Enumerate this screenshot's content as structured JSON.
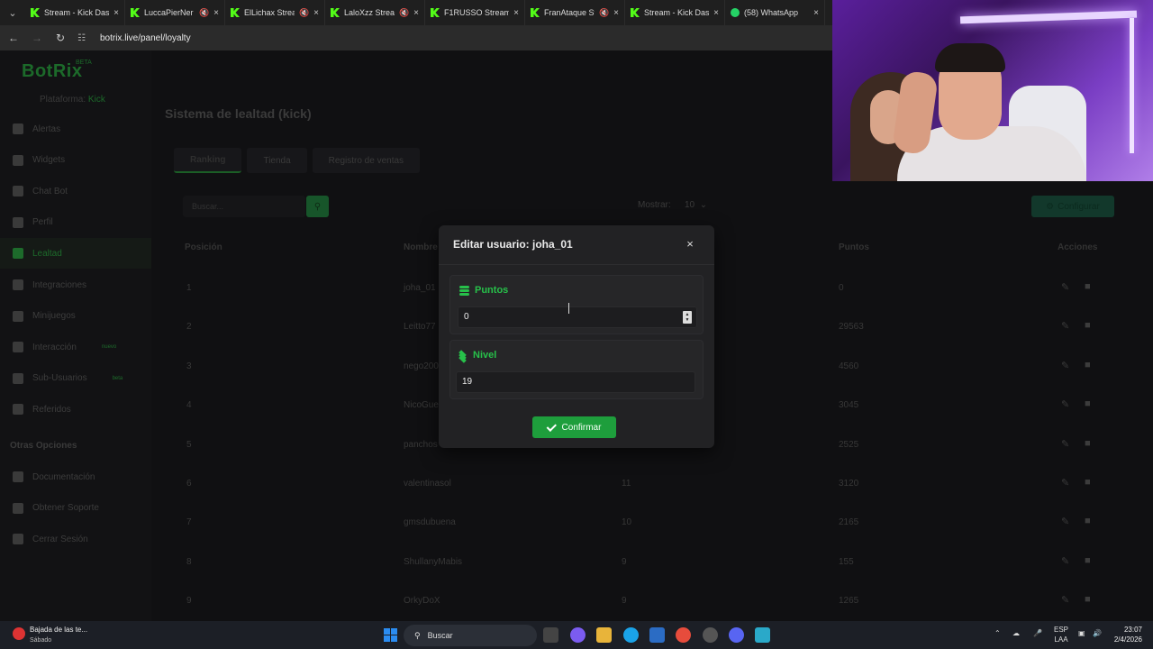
{
  "browser": {
    "tabs": [
      {
        "label": "Stream - Kick Das",
        "icon": "kick-icon",
        "muted": false
      },
      {
        "label": "LuccaPierNer",
        "icon": "kick-icon",
        "muted": true
      },
      {
        "label": "ElLichax Stream",
        "icon": "kick-icon",
        "muted": true
      },
      {
        "label": "LaloXzz Stream",
        "icon": "kick-icon",
        "muted": true
      },
      {
        "label": "F1RUSSO Stream",
        "icon": "kick-icon",
        "muted": false
      },
      {
        "label": "FranAtaque St",
        "icon": "kick-icon",
        "muted": true
      },
      {
        "label": "Stream - Kick Das",
        "icon": "kick-icon",
        "muted": false
      },
      {
        "label": "(58) WhatsApp",
        "icon": "whatsapp-icon",
        "muted": false
      }
    ],
    "url": "botrix.live/panel/loyalty"
  },
  "sidebar": {
    "logo": "BotRix",
    "beta": "BETA",
    "platform_label": "Plataforma:",
    "platform_value": "Kick",
    "items": [
      {
        "label": "Alertas"
      },
      {
        "label": "Widgets"
      },
      {
        "label": "Chat Bot"
      },
      {
        "label": "Perfil"
      },
      {
        "label": "Lealtad"
      },
      {
        "label": "Integraciones"
      },
      {
        "label": "Minijuegos"
      },
      {
        "label": "Interacción",
        "badge": "nuevo"
      },
      {
        "label": "Sub-Usuarios",
        "badge": "beta"
      },
      {
        "label": "Referidos"
      }
    ],
    "section": "Otras Opciones",
    "other_items": [
      {
        "label": "Documentación"
      },
      {
        "label": "Obtener Soporte"
      },
      {
        "label": "Cerrar Sesión"
      }
    ]
  },
  "main": {
    "title": "Sistema de lealtad (kick)",
    "tabs": [
      "Ranking",
      "Tienda",
      "Registro de ventas"
    ],
    "search_placeholder": "Buscar...",
    "show_label": "Mostrar:",
    "show_value": "10",
    "config_label": "Configurar",
    "columns": [
      "Posición",
      "Nombre",
      "Puntos",
      "Acciones"
    ],
    "rows": [
      {
        "pos": "1",
        "name": "joha_01",
        "level": "",
        "points": "0"
      },
      {
        "pos": "2",
        "name": "Leitto77",
        "level": "",
        "points": "29563"
      },
      {
        "pos": "3",
        "name": "nego200",
        "level": "",
        "points": "4560"
      },
      {
        "pos": "4",
        "name": "NicoGue",
        "level": "",
        "points": "3045"
      },
      {
        "pos": "5",
        "name": "panchos",
        "level": "",
        "points": "2525"
      },
      {
        "pos": "6",
        "name": "valentinasol",
        "level": "11",
        "points": "3120"
      },
      {
        "pos": "7",
        "name": "gmsdubuena",
        "level": "10",
        "points": "2165"
      },
      {
        "pos": "8",
        "name": "ShullanyMabis",
        "level": "9",
        "points": "155"
      },
      {
        "pos": "9",
        "name": "OrkyDoX",
        "level": "9",
        "points": "1265"
      }
    ]
  },
  "modal": {
    "title": "Editar usuario: joha_01",
    "points_label": "Puntos",
    "points_value": "0",
    "level_label": "Nivel",
    "level_value": "19",
    "confirm_label": "Confirmar",
    "close_glyph": "×"
  },
  "taskbar": {
    "notification_title": "Bajada de las te...",
    "notification_sub": "Sábado",
    "search_label": "Buscar",
    "lang_top": "ESP",
    "lang_bottom": "LAA",
    "time": "23:07",
    "date": "2/4/2026"
  },
  "colors": {
    "accent": "#27c04a",
    "confirm": "#1e9e3c",
    "modal_bg": "#222224"
  }
}
